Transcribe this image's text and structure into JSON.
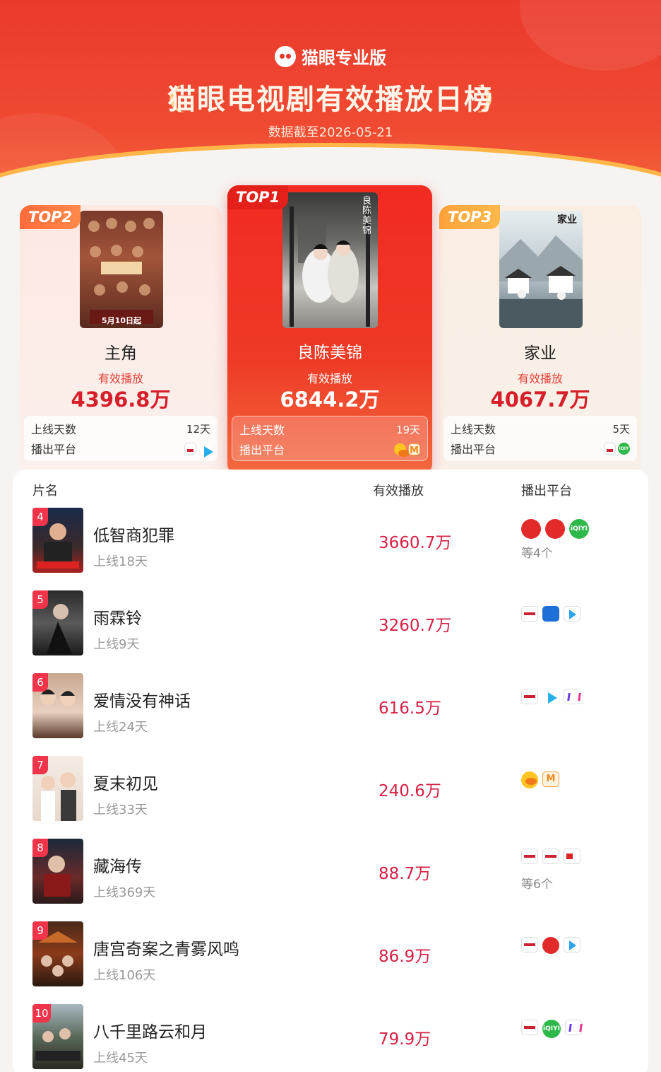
{
  "header": {
    "brand": "猫眼专业版",
    "title": "猫眼电视剧有效播放日榜",
    "date_text": "数据截至2026-05-21"
  },
  "podium": [
    {
      "rank_label": "TOP2",
      "poster_text": "5月10日起",
      "name": "主角",
      "metric_label": "有效播放",
      "value": "4396.8万",
      "days_label": "上线天数",
      "days": "12天",
      "platform_label": "播出平台",
      "platforms": [
        "cctv-icon",
        "tencent-video-icon"
      ]
    },
    {
      "rank_label": "TOP1",
      "poster_text": "良陈美锦",
      "name": "良陈美锦",
      "metric_label": "有效播放",
      "value": "6844.2万",
      "days_label": "上线天数",
      "days": "19天",
      "platform_label": "播出平台",
      "platforms": [
        "hunan-tv-icon",
        "mango-tv-icon"
      ]
    },
    {
      "rank_label": "TOP3",
      "poster_text": "家业",
      "name": "家业",
      "metric_label": "有效播放",
      "value": "4067.7万",
      "days_label": "上线天数",
      "days": "5天",
      "platform_label": "播出平台",
      "platforms": [
        "cctv-icon",
        "iqiyi-icon"
      ]
    }
  ],
  "table": {
    "headers": {
      "name": "片名",
      "value": "有效播放",
      "platform": "播出平台"
    },
    "rows": [
      {
        "rank": "4",
        "name": "低智商犯罪",
        "days": "上线18天",
        "value": "3660.7万",
        "platforms": [
          "dragon-tv-icon",
          "dragon-tv-icon",
          "iqiyi-icon"
        ],
        "more": "等4个"
      },
      {
        "rank": "5",
        "name": "雨霖铃",
        "days": "上线9天",
        "value": "3260.7万",
        "platforms": [
          "cctv-icon",
          "zhejiang-tv-icon",
          "youku-icon"
        ],
        "more": ""
      },
      {
        "rank": "6",
        "name": "爱情没有神话",
        "days": "上线24天",
        "value": "616.5万",
        "platforms": [
          "cctv-icon",
          "tencent-video-icon",
          "mgtv-icon"
        ],
        "more": ""
      },
      {
        "rank": "7",
        "name": "夏末初见",
        "days": "上线33天",
        "value": "240.6万",
        "platforms": [
          "hunan-tv-icon",
          "mango-tv-icon"
        ],
        "more": ""
      },
      {
        "rank": "8",
        "name": "藏海传",
        "days": "上线369天",
        "value": "88.7万",
        "platforms": [
          "cctv-icon",
          "cctv-icon",
          "btv-icon"
        ],
        "more": "等6个"
      },
      {
        "rank": "9",
        "name": "唐宫奇案之青雾风鸣",
        "days": "上线106天",
        "value": "86.9万",
        "platforms": [
          "cctv-icon",
          "dragon-tv-icon",
          "youku-icon"
        ],
        "more": ""
      },
      {
        "rank": "10",
        "name": "八千里路云和月",
        "days": "上线45天",
        "value": "79.9万",
        "platforms": [
          "cctv-icon",
          "iqiyi-icon",
          "mgtv-icon"
        ],
        "more": ""
      }
    ]
  },
  "colors": {
    "accent": "#e8372b",
    "value_red": "#d61f44"
  }
}
